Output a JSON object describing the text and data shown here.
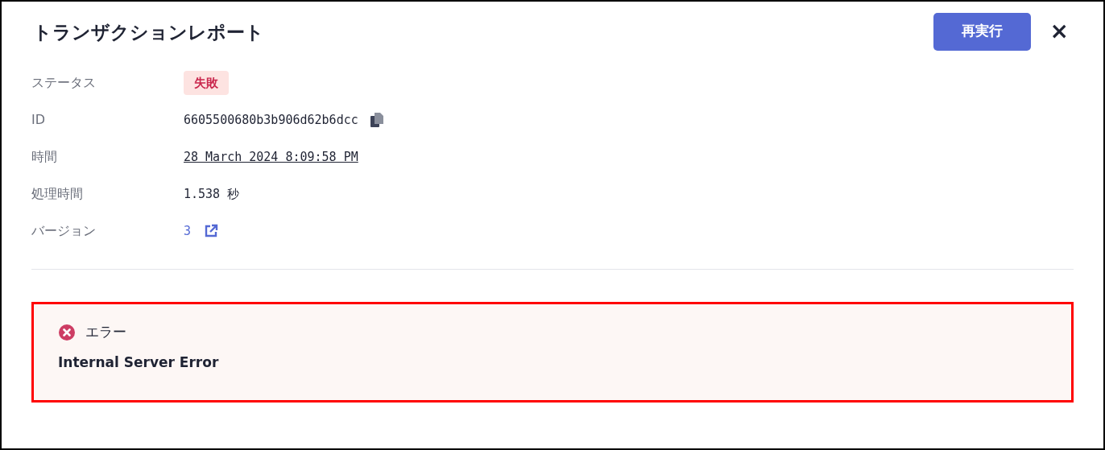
{
  "title": "トランザクションレポート",
  "rerun_button": "再実行",
  "close_button": "×",
  "fields": [
    {
      "label": "ステータス",
      "kind": "badge",
      "value": "失敗"
    },
    {
      "label": "ID",
      "kind": "copy",
      "value": "6605500680b3b906d62b6dcc"
    },
    {
      "label": "時間",
      "kind": "underlined",
      "value": "28 March 2024 8:09:58 PM"
    },
    {
      "label": "処理時間",
      "kind": "plain",
      "value": "1.538 秒"
    },
    {
      "label": "バージョン",
      "kind": "external-link",
      "value": "3"
    }
  ],
  "error": {
    "title": "エラー",
    "message": "Internal Server Error",
    "highlighted": true
  }
}
